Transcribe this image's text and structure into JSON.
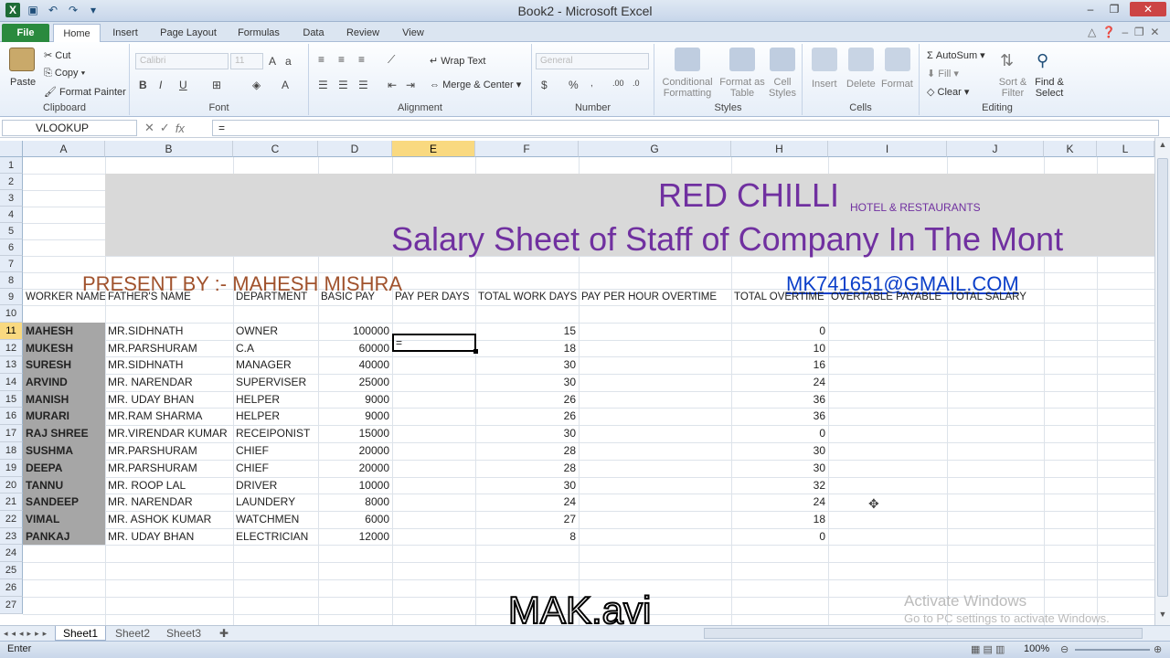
{
  "window": {
    "title": "Book2  -  Microsoft Excel"
  },
  "tabs": [
    "File",
    "Home",
    "Insert",
    "Page Layout",
    "Formulas",
    "Data",
    "Review",
    "View"
  ],
  "ribbon": {
    "clipboard": {
      "paste": "Paste",
      "cut": "Cut",
      "copy": "Copy",
      "format_painter": "Format Painter",
      "label": "Clipboard"
    },
    "font": {
      "name": "Calibri",
      "size": "11",
      "label": "Font"
    },
    "alignment": {
      "wrap": "Wrap Text",
      "merge": "Merge & Center",
      "label": "Alignment"
    },
    "number": {
      "format": "General",
      "label": "Number"
    },
    "styles": {
      "conditional": "Conditional Formatting",
      "format_table": "Format as Table",
      "cell_styles": "Cell Styles",
      "label": "Styles"
    },
    "cells": {
      "insert": "Insert",
      "delete": "Delete",
      "format": "Format",
      "label": "Cells"
    },
    "editing": {
      "autosum": "AutoSum",
      "fill": "Fill",
      "clear": "Clear",
      "sort": "Sort & Filter",
      "find": "Find & Select",
      "label": "Editing"
    }
  },
  "formula_bar": {
    "name_box": "VLOOKUP",
    "formula": "="
  },
  "columns": [
    "A",
    "B",
    "C",
    "D",
    "E",
    "F",
    "G",
    "H",
    "I",
    "J",
    "K",
    "L"
  ],
  "rows": [
    "1",
    "2",
    "3",
    "4",
    "5",
    "6",
    "7",
    "8",
    "9",
    "10",
    "11",
    "12",
    "13",
    "14",
    "15",
    "16",
    "17",
    "18",
    "19",
    "20",
    "21",
    "22",
    "23",
    "24",
    "25",
    "26",
    "27"
  ],
  "sheet": {
    "brand": "RED CHILLI",
    "brand_sub": "HOTEL & RESTAURANTS",
    "heading": "Salary Sheet of Staff of Company In The Mont",
    "presenter": "PRESENT BY :- MAHESH MISHRA",
    "email": "MK741651@GMAIL.COM",
    "headers": [
      "WORKER NAME",
      "FATHER'S NAME",
      "DEPARTMENT",
      "BASIC PAY",
      "PAY PER DAYS",
      "TOTAL WORK DAYS",
      "PAY PER HOUR OVERTIME",
      "TOTAL OVERTIME",
      "OVERTABLE PAYABLE",
      "TOTAL SALARY"
    ],
    "active_cell_text": "=",
    "rows": [
      {
        "name": "MAHESH",
        "father": "MR.SIDHNATH",
        "dept": "OWNER",
        "basic": "100000",
        "days": "15",
        "ot": "0"
      },
      {
        "name": "MUKESH",
        "father": "MR.PARSHURAM",
        "dept": "C.A",
        "basic": "60000",
        "days": "18",
        "ot": "10"
      },
      {
        "name": "SURESH",
        "father": "MR.SIDHNATH",
        "dept": "MANAGER",
        "basic": "40000",
        "days": "30",
        "ot": "16"
      },
      {
        "name": "ARVIND",
        "father": "MR. NARENDAR",
        "dept": "SUPERVISER",
        "basic": "25000",
        "days": "30",
        "ot": "24"
      },
      {
        "name": "MANISH",
        "father": "MR. UDAY BHAN",
        "dept": "HELPER",
        "basic": "9000",
        "days": "26",
        "ot": "36"
      },
      {
        "name": "MURARI",
        "father": "MR.RAM SHARMA",
        "dept": "HELPER",
        "basic": "9000",
        "days": "26",
        "ot": "36"
      },
      {
        "name": "RAJ SHREE",
        "father": "MR.VIRENDAR KUMAR",
        "dept": "RECEIPONIST",
        "basic": "15000",
        "days": "30",
        "ot": "0"
      },
      {
        "name": "SUSHMA",
        "father": "MR.PARSHURAM",
        "dept": "CHIEF",
        "basic": "20000",
        "days": "28",
        "ot": "30"
      },
      {
        "name": "DEEPA",
        "father": "MR.PARSHURAM",
        "dept": "CHIEF",
        "basic": "20000",
        "days": "28",
        "ot": "30"
      },
      {
        "name": "TANNU",
        "father": "MR. ROOP LAL",
        "dept": "DRIVER",
        "basic": "10000",
        "days": "30",
        "ot": "32"
      },
      {
        "name": "SANDEEP",
        "father": "MR. NARENDAR",
        "dept": "LAUNDERY",
        "basic": "8000",
        "days": "24",
        "ot": "24"
      },
      {
        "name": "VIMAL",
        "father": "MR. ASHOK KUMAR",
        "dept": "WATCHMEN",
        "basic": "6000",
        "days": "27",
        "ot": "18"
      },
      {
        "name": "PANKAJ",
        "father": "MR. UDAY BHAN",
        "dept": "ELECTRICIAN",
        "basic": "12000",
        "days": "8",
        "ot": "0"
      }
    ]
  },
  "sheet_tabs": [
    "Sheet1",
    "Sheet2",
    "Sheet3"
  ],
  "watermark": {
    "line1": "Activate Windows",
    "line2": "Go to PC settings to activate Windows."
  },
  "overlay": "MAK.avi",
  "status": {
    "mode": "Enter",
    "zoom": "100%"
  },
  "colors": {
    "purple": "#7030a0",
    "brown": "#a0522d",
    "band": "#d9d9d9",
    "name_fill": "#a6a6a6",
    "file_tab": "#2a8a3e"
  }
}
